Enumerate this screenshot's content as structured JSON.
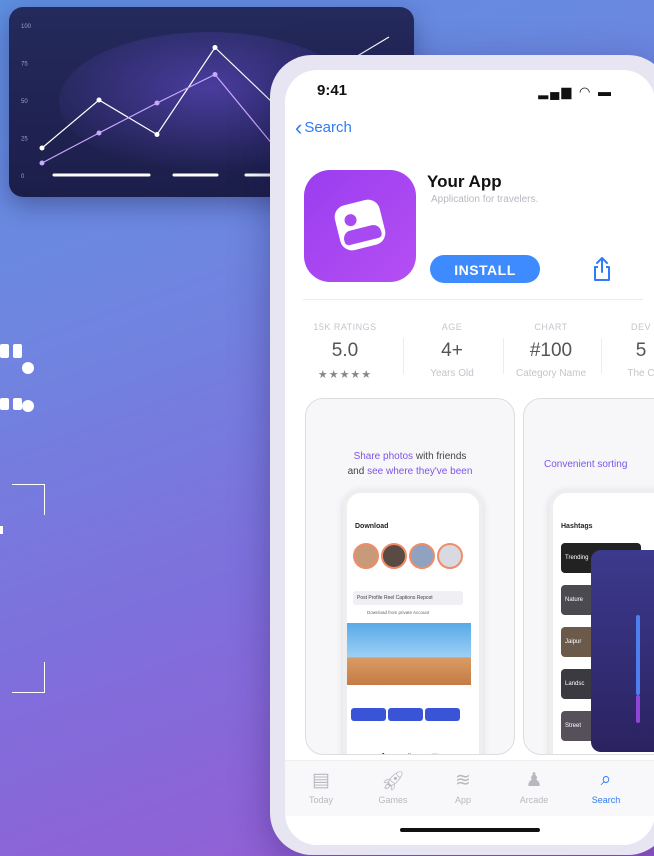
{
  "chart_data": {
    "type": "line",
    "y_ticks": [
      "100",
      "75",
      "50",
      "25",
      "0"
    ],
    "ylim": [
      0,
      100
    ],
    "grid": false,
    "series": [
      {
        "color": "#ffffff",
        "values": [
          18,
          50,
          27,
          85,
          48,
          68
        ]
      },
      {
        "color": "#c9a8ff",
        "values": [
          8,
          28,
          48,
          67,
          20,
          55
        ]
      }
    ]
  },
  "status": {
    "time": "9:41",
    "icons": "signal wifi battery"
  },
  "nav": {
    "back_label": "Search"
  },
  "app": {
    "name": "Your App",
    "subtitle": "Application for travelers.",
    "install_label": "INSTALL"
  },
  "stats": [
    {
      "label": "15K RATINGS",
      "value": "5.0",
      "sub": "★★★★★"
    },
    {
      "label": "AGE",
      "value": "4+",
      "sub": "Years Old"
    },
    {
      "label": "CHART",
      "value": "#100",
      "sub": "Category Name"
    },
    {
      "label": "DEV",
      "value": "5",
      "sub": "The C"
    }
  ],
  "screenshots": {
    "card1": {
      "highlight1": "Share photos",
      "text1": " with friends",
      "text2": "and ",
      "highlight2": "see where they've been",
      "mini_title": "Download",
      "mini_button": "Post Profile Reel Captions Repost",
      "mini_toggle": "Download from private Account"
    },
    "card2": {
      "caption": "Convenient sorting",
      "mini_title": "Hashtags",
      "tags": [
        "Trending",
        "Nature",
        "Jaipur",
        "Landsc",
        "Street"
      ]
    }
  },
  "tabs": [
    {
      "label": "Today",
      "icon": "today-icon",
      "active": false
    },
    {
      "label": "Games",
      "icon": "rocket-icon",
      "active": false
    },
    {
      "label": "App",
      "icon": "layers-icon",
      "active": false
    },
    {
      "label": "Arcade",
      "icon": "joystick-icon",
      "active": false
    },
    {
      "label": "Search",
      "icon": "search-icon",
      "active": true
    }
  ],
  "colors": {
    "accent": "#3d8bff",
    "brand": "#a84af1",
    "link": "#2f7cf6"
  }
}
